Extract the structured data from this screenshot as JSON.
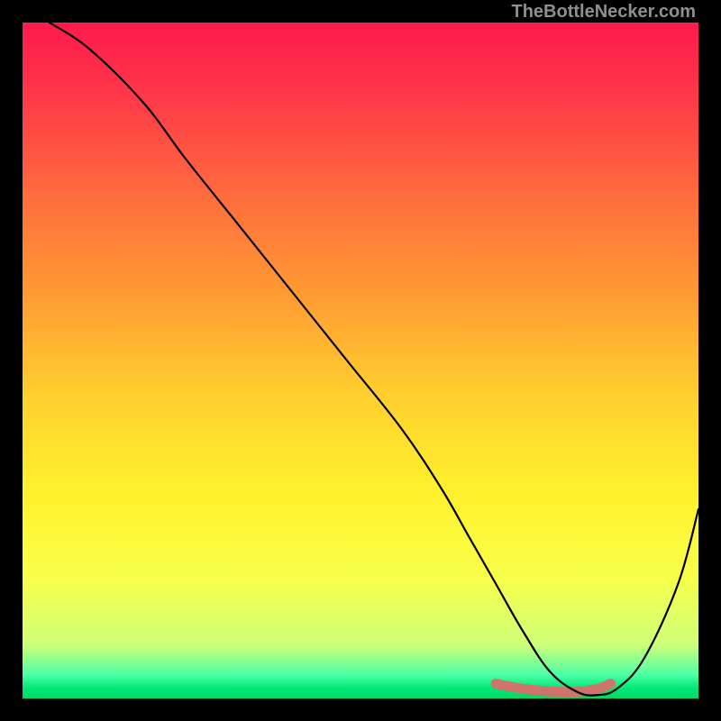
{
  "attribution": "TheBottleNecker.com",
  "chart_data": {
    "type": "line",
    "title": "",
    "xlabel": "",
    "ylabel": "",
    "xlim": [
      0,
      100
    ],
    "ylim": [
      0,
      100
    ],
    "series": [
      {
        "name": "bottleneck-curve",
        "x": [
          4,
          10,
          18,
          24,
          32,
          40,
          48,
          56,
          62,
          66,
          70,
          74,
          78,
          82,
          85,
          88,
          92,
          97,
          100
        ],
        "values": [
          100,
          96,
          88,
          80,
          70,
          60,
          50,
          40,
          31,
          24,
          17,
          10,
          4,
          1,
          0.5,
          1.5,
          6,
          17,
          28
        ]
      },
      {
        "name": "optimal-band",
        "x": [
          70,
          73,
          76,
          79,
          82,
          85,
          87
        ],
        "values": [
          2.2,
          1.6,
          1.2,
          1.0,
          1.0,
          1.4,
          2.2
        ]
      }
    ],
    "gradient_stops": [
      {
        "offset": 0,
        "color": "#ff1a4d"
      },
      {
        "offset": 0.1,
        "color": "#ff3549"
      },
      {
        "offset": 0.25,
        "color": "#ff6a3e"
      },
      {
        "offset": 0.4,
        "color": "#ff9a33"
      },
      {
        "offset": 0.55,
        "color": "#ffcf2e"
      },
      {
        "offset": 0.7,
        "color": "#fff22c"
      },
      {
        "offset": 0.82,
        "color": "#f8ff4a"
      },
      {
        "offset": 0.92,
        "color": "#cfff78"
      },
      {
        "offset": 0.965,
        "color": "#4dffa6"
      },
      {
        "offset": 0.985,
        "color": "#00e878"
      },
      {
        "offset": 1.0,
        "color": "#00d865"
      }
    ],
    "band_marker_color": "#e06a6a",
    "curve_color": "#000000"
  }
}
